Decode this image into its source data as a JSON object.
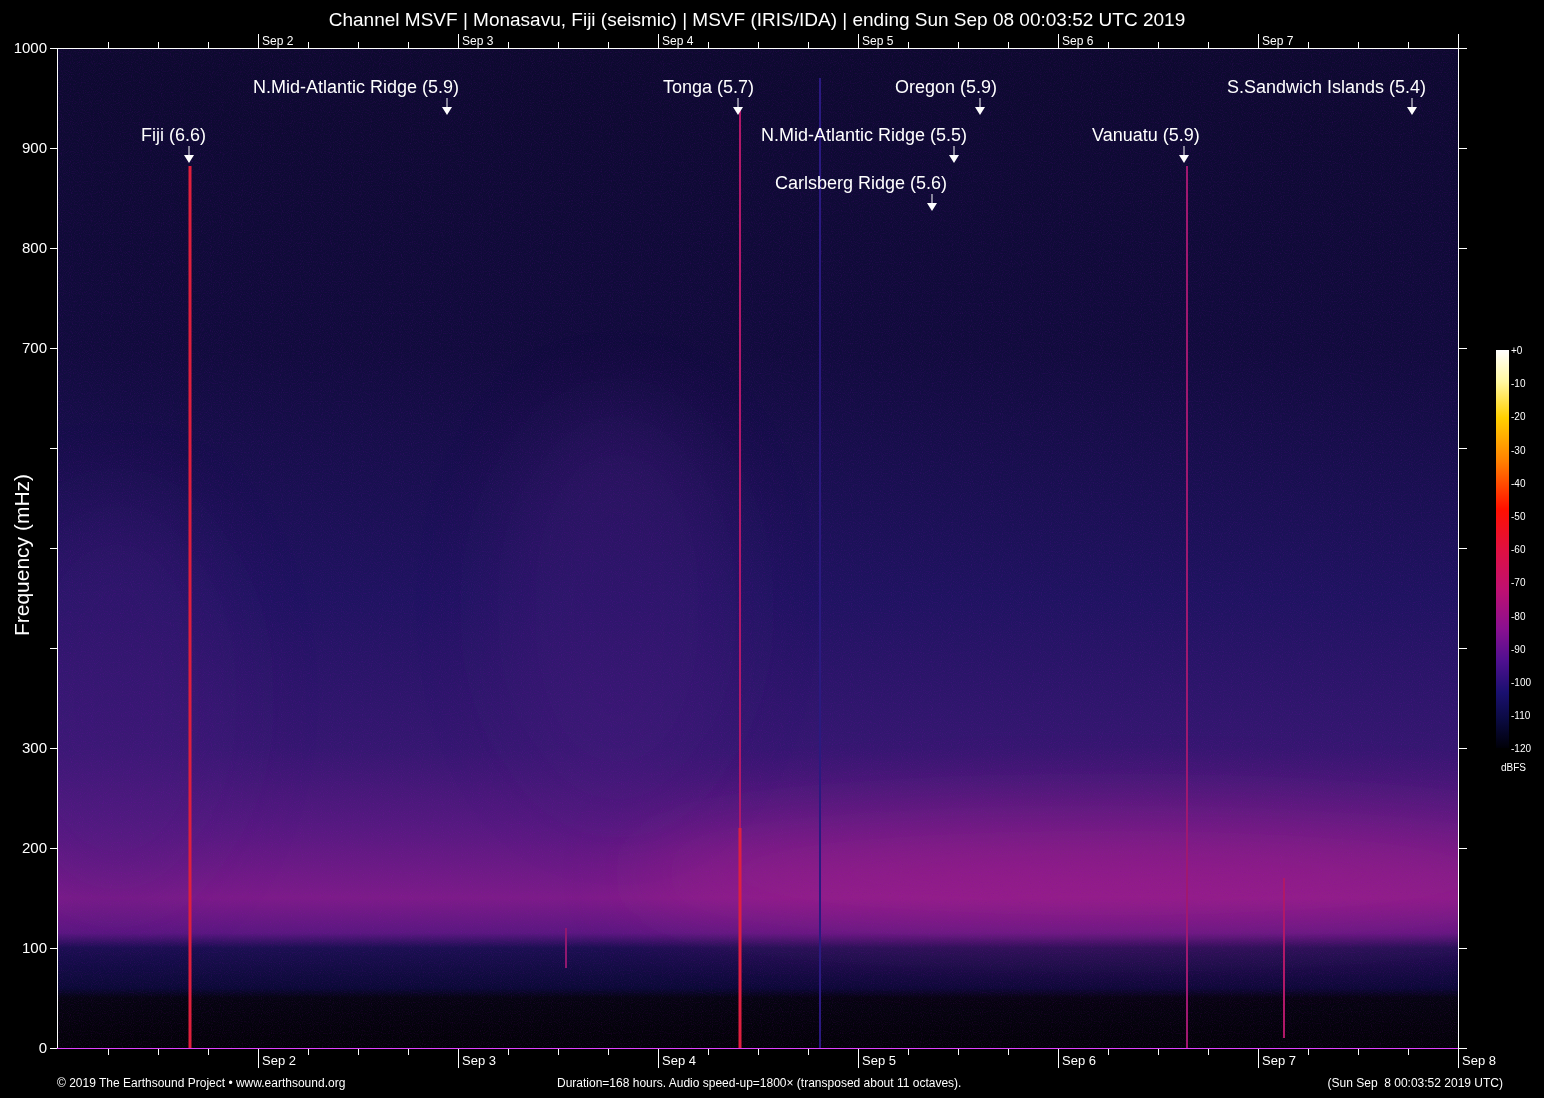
{
  "title": "Channel MSVF | Monasavu, Fiji (seismic) | MSVF (IRIS/IDA) | ending Sun Sep 08 00:03:52 UTC 2019",
  "y_axis": {
    "label": "Frequency (mHz)",
    "tick_labels": [
      "1000",
      "900",
      "800",
      "700",
      "300",
      "200",
      "100",
      "0"
    ]
  },
  "x_axis_top": {
    "tick_labels": [
      "Sep 2",
      "Sep 3",
      "Sep 4",
      "Sep 5",
      "Sep 6",
      "Sep 7"
    ]
  },
  "x_axis_bottom": {
    "tick_labels": [
      "Sep 2",
      "Sep 3",
      "Sep 4",
      "Sep 5",
      "Sep 6",
      "Sep 7",
      "Sep 8"
    ]
  },
  "events": [
    {
      "label": "Fiji (6.6)"
    },
    {
      "label": "N.Mid-Atlantic Ridge (5.9)"
    },
    {
      "label": "Tonga (5.7)"
    },
    {
      "label": "N.Mid-Atlantic Ridge (5.5)"
    },
    {
      "label": "Carlsberg Ridge (5.6)"
    },
    {
      "label": "Oregon (5.9)"
    },
    {
      "label": "Vanuatu (5.9)"
    },
    {
      "label": "S.Sandwich Islands (5.4)"
    }
  ],
  "colorbar": {
    "tick_labels": [
      "+0",
      "-10",
      "-20",
      "-30",
      "-40",
      "-50",
      "-60",
      "-70",
      "-80",
      "-90",
      "-100",
      "-110",
      "-120"
    ],
    "unit": "dBFS"
  },
  "footer": {
    "credit": "© 2019 The Earthsound Project • www.earthsound.org",
    "details": "Duration=168 hours. Audio speed-up=1800× (transposed about 11 octaves).",
    "timestamp": "(Sun Sep  8 00:03:52 2019 UTC)"
  }
}
